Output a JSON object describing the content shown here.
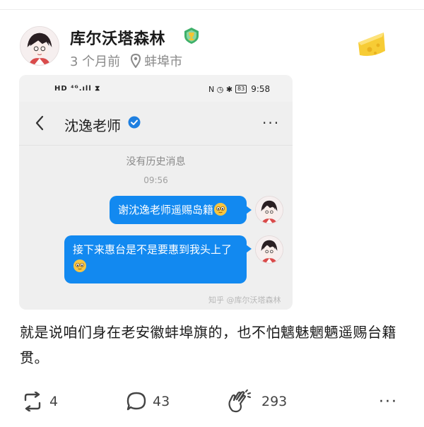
{
  "post": {
    "author": "库尔沃塔森林",
    "time": "3 个月前",
    "location": "蚌埠市",
    "content": "就是说咱们身在老安徽蚌埠旗的，也不怕魑魅魍魉遥赐台籍贯。"
  },
  "screenshot": {
    "status_left": "HD ⁴ᴳ.ıll ⧗",
    "status_right_icons": "N ◷ ✱",
    "battery": "83",
    "status_time": "9:58",
    "chat_name": "沈逸老师",
    "more_label": "···",
    "no_history": "没有历史消息",
    "message_time": "09:56",
    "messages": [
      {
        "text": "谢沈逸老师遥赐岛籍"
      },
      {
        "text": "接下来惠台是不是要惠到我头上了"
      }
    ],
    "watermark": "知乎 @库尔沃塔森林"
  },
  "actions": {
    "repost_count": "4",
    "comment_count": "43",
    "like_count": "293",
    "more_label": "···"
  },
  "colors": {
    "bubble_blue": "#1289f0",
    "verify_blue": "#1e7fe0",
    "meta_gray": "#8a8a8a"
  },
  "icons": [
    "avatar",
    "badge-icon",
    "location-pin-icon",
    "cheese-sticker-icon",
    "back-arrow-icon",
    "verified-icon",
    "emoji-icon",
    "repost-icon",
    "comment-icon",
    "clap-icon",
    "more-icon"
  ]
}
